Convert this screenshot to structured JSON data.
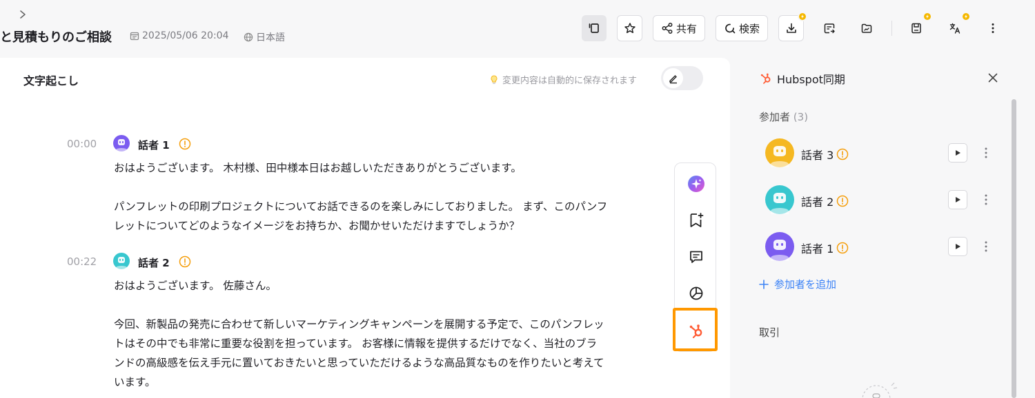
{
  "header": {
    "meeting_title": "と見積もりのご相談",
    "date": "2025/05/06 20:04",
    "language": "日本語",
    "share_label": "共有",
    "search_label": "検索"
  },
  "transcript": {
    "title": "文字起こし",
    "autosave_notice": "変更内容は自動的に保存されます",
    "entries": [
      {
        "time": "00:00",
        "speaker": "話者 1",
        "paragraphs": [
          "おはようございます。 木村様、田中様本日はお越しいただきありがとうございます。",
          "パンフレットの印刷プロジェクトについてお話できるのを楽しみにしておりました。 まず、このパンフレットについてどのようなイメージをお持ちか、お聞かせいただけますでしょうか？"
        ]
      },
      {
        "time": "00:22",
        "speaker": "話者 2",
        "paragraphs": [
          "おはようございます。 佐藤さん。",
          "今回、新製品の発売に合わせて新しいマーケティングキャンペーンを展開する予定で、このパンフレットはその中でも非常に重要な役割を担っています。 お客様に情報を提供するだけでなく、当社のブランドの高級感を伝え手元に置いておきたいと思っていただけるような高品質なものを作りたいと考えています。"
        ]
      }
    ]
  },
  "hubspot": {
    "title": "Hubspot同期",
    "participants_label": "参加者",
    "participants_count": "(3)",
    "participants": [
      {
        "name": "話者 3"
      },
      {
        "name": "話者 2"
      },
      {
        "name": "話者 1"
      }
    ],
    "add_participant_label": "参加者を追加",
    "deal_label": "取引"
  },
  "colors": {
    "hubspot_orange": "#ff5c35",
    "highlight": "#ff9800",
    "warn": "#f59e0b",
    "link_blue": "#3b82f6"
  }
}
